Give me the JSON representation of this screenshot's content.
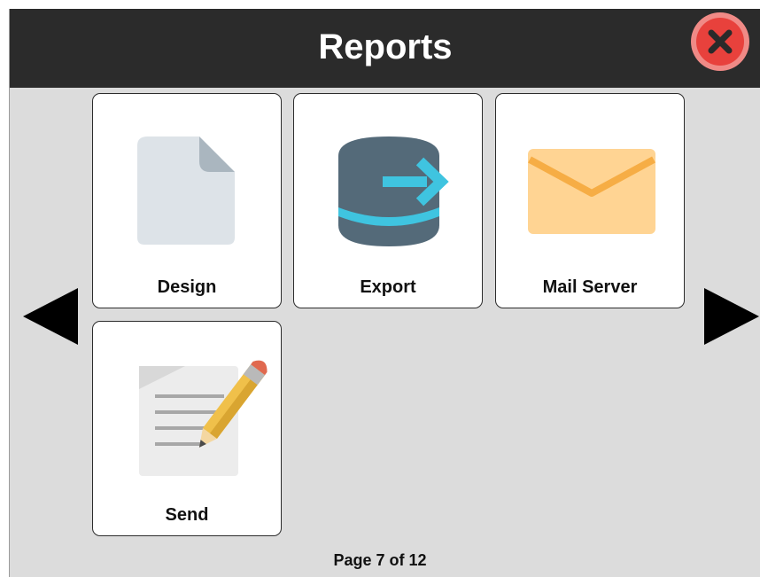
{
  "header": {
    "title": "Reports"
  },
  "tiles": [
    {
      "label": "Design",
      "icon": "document-icon"
    },
    {
      "label": "Export",
      "icon": "database-export-icon"
    },
    {
      "label": "Mail Server",
      "icon": "envelope-icon"
    },
    {
      "label": "Send",
      "icon": "note-pencil-icon"
    }
  ],
  "pagination": {
    "text": "Page 7 of 12",
    "current": 7,
    "total": 12
  },
  "colors": {
    "header_bg": "#2b2b2b",
    "panel_bg": "#dcdcdc",
    "close_button": "#e8413c",
    "title_text": "#ffffff"
  },
  "icons": {
    "close": "close-icon",
    "previous": "arrow-left-icon",
    "next": "arrow-right-icon"
  }
}
